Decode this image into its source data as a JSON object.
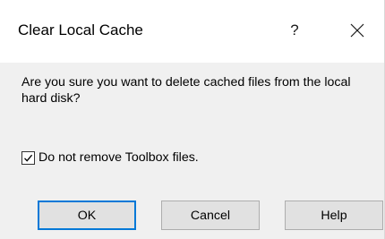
{
  "dialog": {
    "title": "Clear Local Cache",
    "help_glyph": "?",
    "close_icon": "close-icon",
    "message": "Are you sure you want to delete cached files from the local hard disk?",
    "checkbox": {
      "label": "Do not remove Toolbox files.",
      "checked": true
    },
    "buttons": {
      "ok": "OK",
      "cancel": "Cancel",
      "help": "Help"
    },
    "colors": {
      "default_button_border": "#0078d7",
      "button_face": "#e1e1e1",
      "content_background": "#f0f0f0"
    }
  }
}
